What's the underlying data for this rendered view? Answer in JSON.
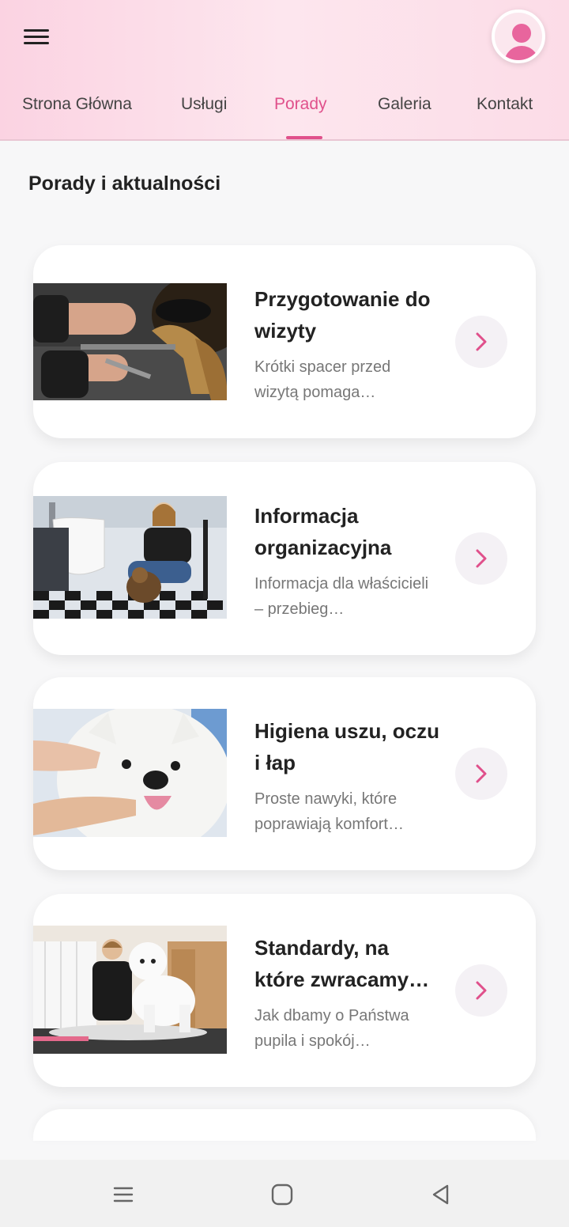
{
  "nav": {
    "tabs": [
      {
        "label": "Strona Główna"
      },
      {
        "label": "Usługi"
      },
      {
        "label": "Porady"
      },
      {
        "label": "Galeria"
      },
      {
        "label": "Kontakt"
      }
    ],
    "active_tab": "Porady"
  },
  "page": {
    "title": "Porady i aktualności"
  },
  "articles": [
    {
      "title": "Przygotowanie do wizyty",
      "excerpt": "Krótki spacer przed wizytą pomaga pupilowi…",
      "image": "grooming-paws-photo"
    },
    {
      "title": "Informacja organizacyjna",
      "excerpt": "Informacja dla właścicieli – przebieg…",
      "image": "groomer-with-dog-photo"
    },
    {
      "title": "Higiena uszu, oczu i łap",
      "excerpt": "Proste nawyki, które poprawiają komfort…",
      "image": "white-samoyed-photo"
    },
    {
      "title": "Standardy, na które zwracamy uwagę",
      "excerpt": "Jak dbamy o Państwa pupila i spokój…",
      "image": "groomer-white-poodle-photo"
    }
  ],
  "colors": {
    "accent": "#e0508b",
    "header_bg": "#fde6ee"
  },
  "icons": [
    "menu-icon",
    "user-avatar-icon",
    "chevron-right-icon",
    "system-recents-icon",
    "system-home-icon",
    "system-back-icon"
  ]
}
